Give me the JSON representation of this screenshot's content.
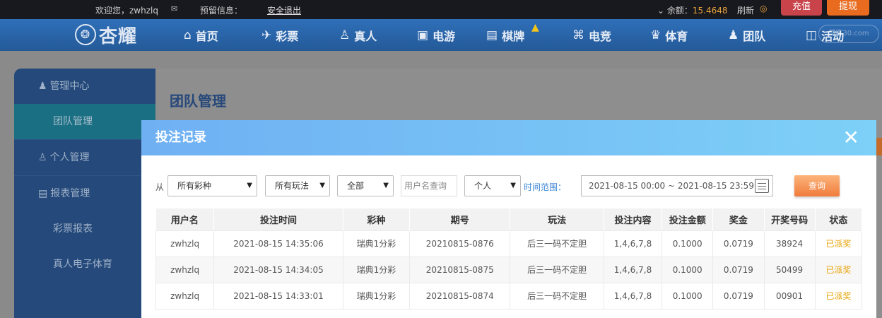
{
  "topbar": {
    "welcome": "欢迎您，zwhzlq",
    "mail_icon": "envelope-icon",
    "notice_label": "预留信息：",
    "logout": "安全退出",
    "balance_label": "余额：",
    "balance_amount": "15.4648",
    "refresh": "刷新",
    "deposit": "充值",
    "withdraw": "提现"
  },
  "nav": {
    "logo_text": "杏耀",
    "items": [
      {
        "icon": "home-icon",
        "label": "首页"
      },
      {
        "icon": "ticket-icon",
        "label": "彩票"
      },
      {
        "icon": "user-icon",
        "label": "真人"
      },
      {
        "icon": "slot-icon",
        "label": "电游"
      },
      {
        "icon": "cards-icon",
        "label": "棋牌"
      },
      {
        "icon": "gamepad-icon",
        "label": "电竞"
      },
      {
        "icon": "trophy-icon",
        "label": "体育"
      },
      {
        "icon": "team-icon",
        "label": "团队"
      },
      {
        "icon": "gift-icon",
        "label": "活动"
      }
    ],
    "watermark": "博客30.com"
  },
  "sidebar": {
    "sections": [
      {
        "label": "管理中心",
        "icon": "group-icon"
      },
      {
        "label": "团队管理",
        "active": true
      },
      {
        "label": "个人管理",
        "icon": "person-icon"
      },
      {
        "label": "报表管理",
        "icon": "report-icon"
      },
      {
        "label": "彩票报表"
      },
      {
        "label": "真人电子体育"
      }
    ]
  },
  "content": {
    "title": "团队管理"
  },
  "modal": {
    "title": "投注记录",
    "close": "✕",
    "filters": {
      "from_label": "从",
      "lottery": "所有彩种",
      "play": "所有玩法",
      "status": "全部",
      "username_placeholder": "用户名查询",
      "scope": "个人",
      "time_label": "时间范围：",
      "time_range": "2021-08-15 00:00 ~ 2021-08-15 23:59",
      "query": "查询"
    },
    "table": {
      "headers": [
        "用户名",
        "投注时间",
        "彩种",
        "期号",
        "玩法",
        "投注内容",
        "投注金额",
        "奖金",
        "开奖号码",
        "状态"
      ],
      "rows": [
        [
          "zwhzlq",
          "2021-08-15 14:35:06",
          "瑞典1分彩",
          "20210815-0876",
          "后三一码不定胆",
          "1,4,6,7,8",
          "0.1000",
          "0.0719",
          "38924",
          "已派奖"
        ],
        [
          "zwhzlq",
          "2021-08-15 14:34:05",
          "瑞典1分彩",
          "20210815-0875",
          "后三一码不定胆",
          "1,4,6,7,8",
          "0.1000",
          "0.0719",
          "50499",
          "已派奖"
        ],
        [
          "zwhzlq",
          "2021-08-15 14:33:01",
          "瑞典1分彩",
          "20210815-0874",
          "后三一码不定胆",
          "1,4,6,7,8",
          "0.1000",
          "0.0719",
          "00901",
          "已派奖"
        ]
      ]
    }
  }
}
